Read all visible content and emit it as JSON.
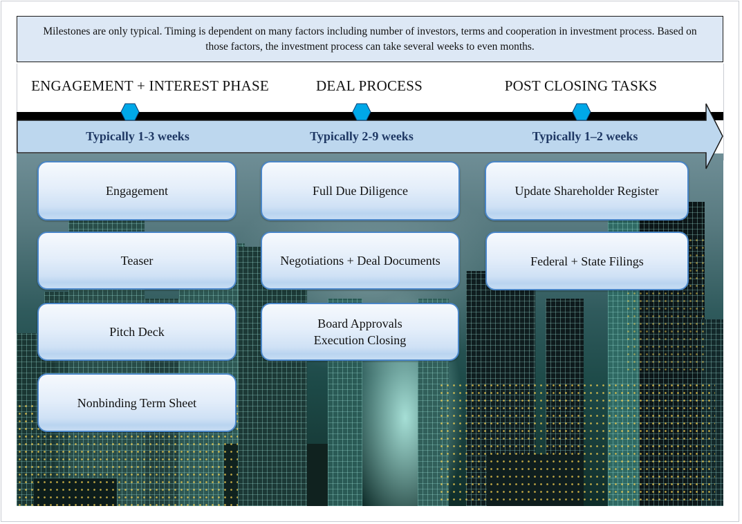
{
  "note": {
    "text": "Milestones are only typical.  Timing is dependent on many factors including number of investors, terms and cooperation in investment process.  Based on those factors, the investment process can take several weeks to even months."
  },
  "colors": {
    "note_background": "#dde8f5",
    "timeline_bar": "#000000",
    "arrow_fill": "#bdd7ee",
    "hexagon_marker": "#00a8e8",
    "duration_text": "#1f3864",
    "card_border": "#4a86c8"
  },
  "phases": [
    {
      "title": "ENGAGEMENT + INTEREST PHASE",
      "duration": "Typically 1-3 weeks",
      "marker_icon": "hexagon-icon",
      "milestones": [
        "Engagement",
        "Teaser",
        "Pitch Deck",
        "Nonbinding Term Sheet"
      ]
    },
    {
      "title": "DEAL PROCESS",
      "duration": "Typically 2-9 weeks",
      "marker_icon": "hexagon-icon",
      "milestones": [
        "Full Due Diligence",
        "Negotiations + Deal Documents",
        "Board Approvals\nExecution Closing"
      ]
    },
    {
      "title": "POST CLOSING TASKS",
      "duration": "Typically 1–2 weeks",
      "marker_icon": "hexagon-icon",
      "milestones": [
        "Update Shareholder Register",
        "Federal + State  Filings"
      ]
    }
  ],
  "background_image": "night-city-skyline"
}
